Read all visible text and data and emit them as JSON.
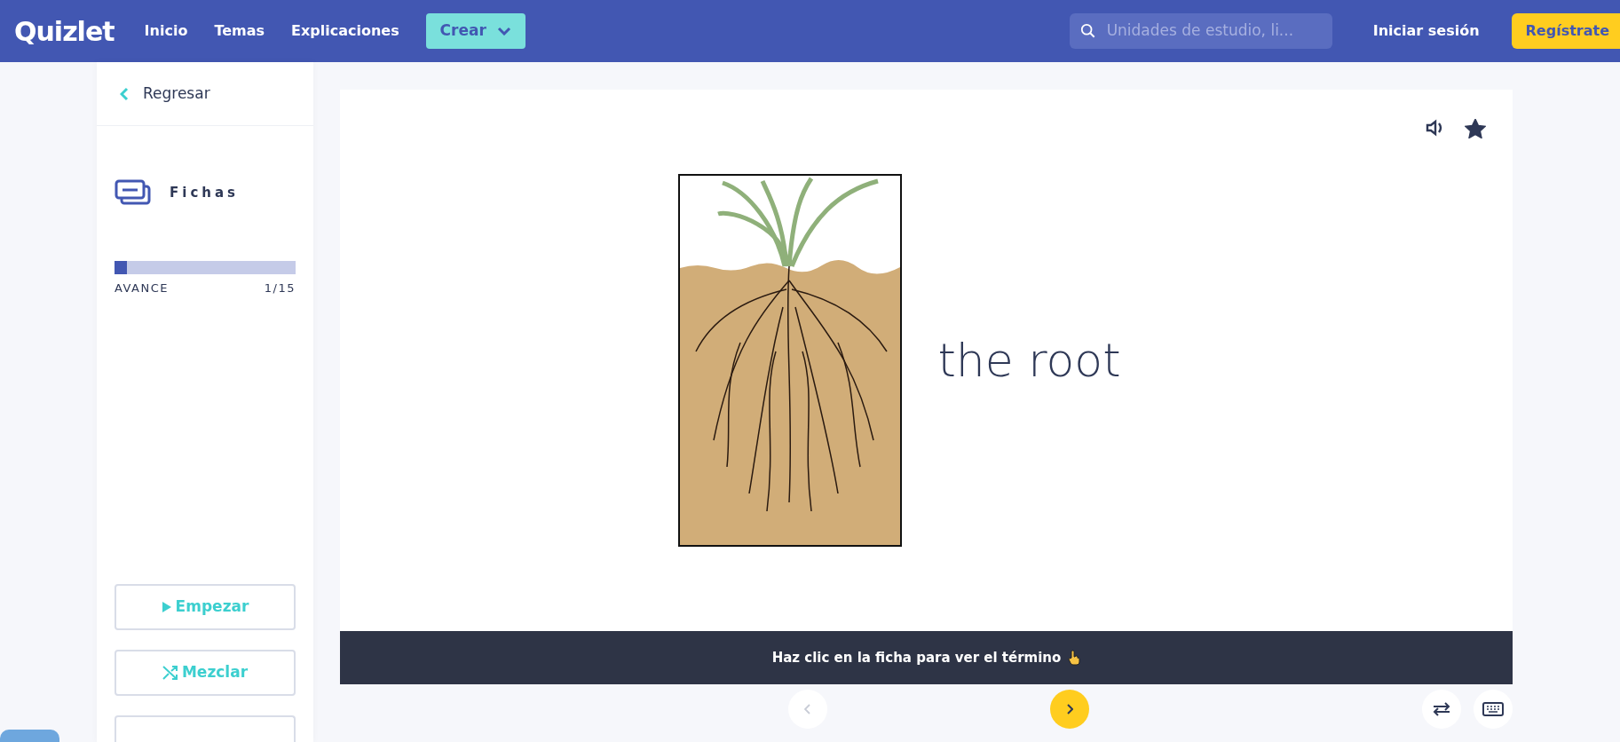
{
  "header": {
    "logo": "Quizlet",
    "nav": [
      {
        "label": "Inicio"
      },
      {
        "label": "Temas"
      },
      {
        "label": "Explicaciones"
      }
    ],
    "create_button": "Crear",
    "search": {
      "placeholder": "Unidades de estudio, li..."
    },
    "login": "Iniciar sesión",
    "signup": "Regístrate"
  },
  "sidebar": {
    "back": "Regresar",
    "mode": "Fichas",
    "progress": {
      "label": "AVANCE",
      "reading": "1/15",
      "level": 0.067
    },
    "buttons": [
      {
        "label": "Empezar",
        "kind": "play"
      },
      {
        "label": "Mezclar",
        "kind": "shuffle"
      },
      {
        "kind": "blank"
      }
    ]
  },
  "card": {
    "term": "the root",
    "starred": true,
    "hint": "Haz clic en la ficha para ver el término"
  },
  "controls": {
    "prev_disabled": true
  }
}
